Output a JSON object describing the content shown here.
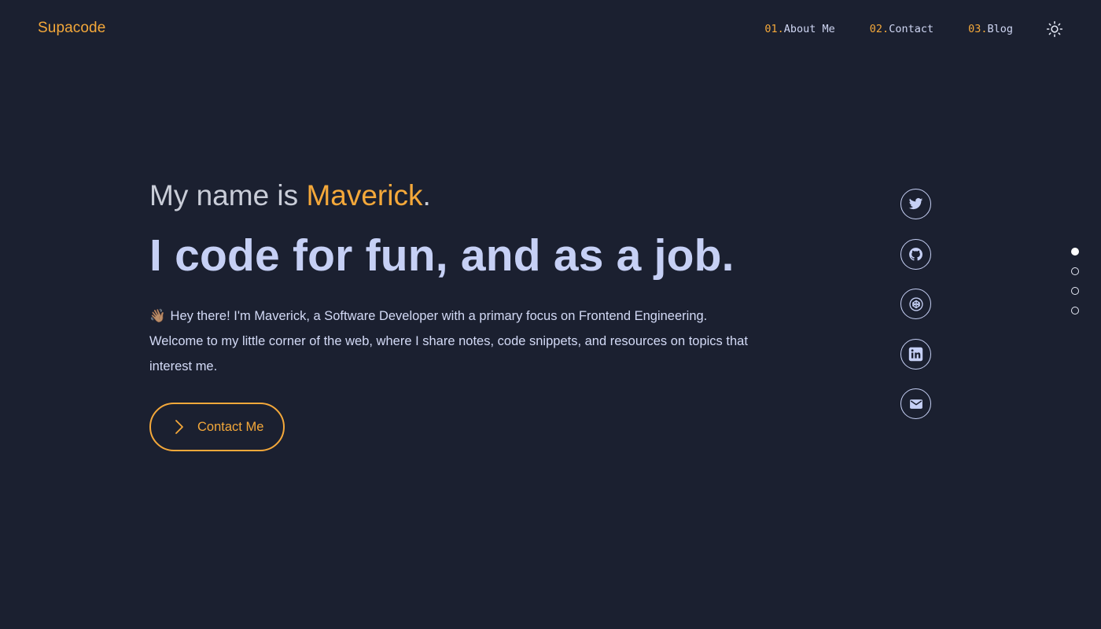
{
  "header": {
    "logo": "Supacode",
    "nav": [
      {
        "num": "01.",
        "label": "About Me"
      },
      {
        "num": "02.",
        "label": "Contact"
      },
      {
        "num": "03.",
        "label": "Blog"
      }
    ],
    "theme_icon": "sun-icon"
  },
  "hero": {
    "intro_prefix": "My name is ",
    "name": "Maverick",
    "intro_suffix": ".",
    "tagline": "I code for fun, and as a job.",
    "wave_emoji": "👋🏽",
    "bio": "Hey there! I'm Maverick, a Software Developer with a primary focus on Frontend Engineering. Welcome to my little corner of the web, where I share notes, code snippets, and resources on topics that interest me.",
    "cta_label": "Contact Me",
    "cta_icon": "chevron-right-icon"
  },
  "socials": [
    "twitter-icon",
    "github-icon",
    "codepen-icon",
    "linkedin-icon",
    "mail-icon"
  ],
  "section_dots": {
    "count": 4,
    "active_index": 0
  },
  "colors": {
    "background": "#1b2030",
    "accent": "#f4a83a",
    "text": "#c6d0f5"
  }
}
